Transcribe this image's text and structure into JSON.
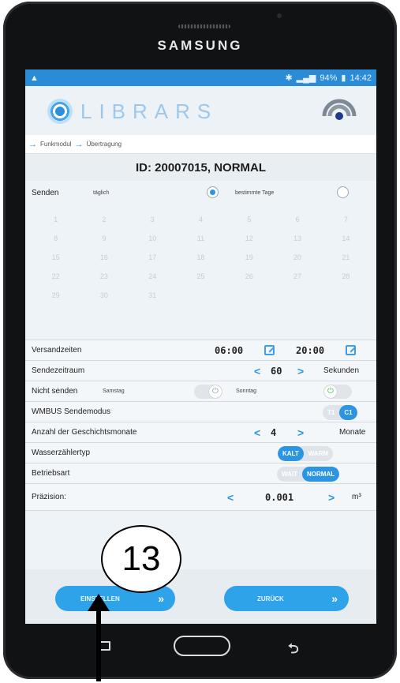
{
  "device": {
    "brand": "SAMSUNG"
  },
  "status_bar": {
    "battery": "94%",
    "time": "14:42"
  },
  "app": {
    "logo_text": "LIBRARS"
  },
  "breadcrumb": [
    "Funkmodul",
    "Übertragung"
  ],
  "page_title": "ID: 20007015, NORMAL",
  "send": {
    "label": "Senden",
    "option_daily": "täglich",
    "option_days": "bestimmte Tage",
    "selected": "täglich"
  },
  "calendar_days": [
    "1",
    "2",
    "3",
    "4",
    "5",
    "6",
    "7",
    "8",
    "9",
    "10",
    "11",
    "12",
    "13",
    "14",
    "15",
    "16",
    "17",
    "18",
    "19",
    "20",
    "21",
    "22",
    "23",
    "24",
    "25",
    "26",
    "27",
    "28",
    "29",
    "30",
    "31"
  ],
  "send_times": {
    "label": "Versandzeiten",
    "start": "06:00",
    "end": "20:00"
  },
  "send_period": {
    "label": "Sendezeitraum",
    "value": "60",
    "unit": "Sekunden"
  },
  "no_send": {
    "label": "Nicht senden",
    "saturday": "Samstag",
    "sunday": "Sonntag",
    "saturday_on": false,
    "sunday_on": true
  },
  "wmbus": {
    "label": "WMBUS Sendemodus",
    "options": [
      "T1",
      "C1"
    ],
    "selected": "C1"
  },
  "history_months": {
    "label": "Anzahl der Geschichtsmonate",
    "value": "4",
    "unit": "Monate"
  },
  "water_meter_type": {
    "label": "Wasserzählertyp",
    "options": [
      "KALT",
      "WARM"
    ],
    "selected": "KALT"
  },
  "operating_mode": {
    "label": "Betriebsart",
    "options": [
      "WAIT",
      "NORMAL"
    ],
    "selected": "NORMAL"
  },
  "precision": {
    "label": "Präzision:",
    "value": "0.001",
    "unit": "m³"
  },
  "buttons": {
    "apply": "EINSTELLEN",
    "back": "ZURÜCK"
  },
  "callout": "13",
  "colors": {
    "accent": "#2b95e3",
    "status_bar": "#2a8bd6",
    "bezel": "#111214"
  }
}
